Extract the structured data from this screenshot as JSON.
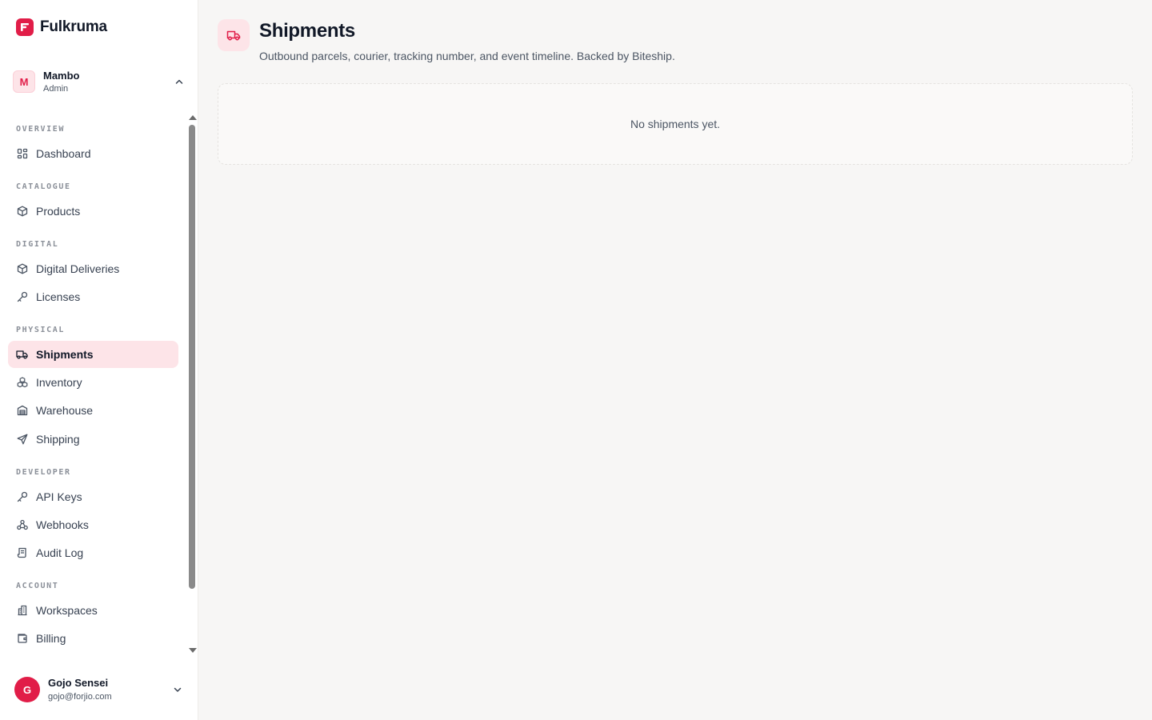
{
  "brand": {
    "name": "Fulkruma",
    "accent": "#e11d48"
  },
  "workspace": {
    "initial": "M",
    "name": "Mambo",
    "role": "Admin"
  },
  "nav": {
    "sections": [
      {
        "label": "OVERVIEW",
        "items": [
          {
            "label": "Dashboard",
            "icon": "dashboard-icon"
          }
        ]
      },
      {
        "label": "CATALOGUE",
        "items": [
          {
            "label": "Products",
            "icon": "box-icon"
          }
        ]
      },
      {
        "label": "DIGITAL",
        "items": [
          {
            "label": "Digital Deliveries",
            "icon": "box-icon"
          },
          {
            "label": "Licenses",
            "icon": "key-icon"
          }
        ]
      },
      {
        "label": "PHYSICAL",
        "items": [
          {
            "label": "Shipments",
            "icon": "truck-icon",
            "active": true
          },
          {
            "label": "Inventory",
            "icon": "boxes-icon"
          },
          {
            "label": "Warehouse",
            "icon": "warehouse-icon"
          },
          {
            "label": "Shipping",
            "icon": "send-icon"
          }
        ]
      },
      {
        "label": "DEVELOPER",
        "items": [
          {
            "label": "API Keys",
            "icon": "key-icon"
          },
          {
            "label": "Webhooks",
            "icon": "webhook-icon"
          },
          {
            "label": "Audit Log",
            "icon": "scroll-icon"
          }
        ]
      },
      {
        "label": "ACCOUNT",
        "items": [
          {
            "label": "Workspaces",
            "icon": "building-icon"
          },
          {
            "label": "Billing",
            "icon": "wallet-icon"
          }
        ]
      }
    ]
  },
  "user": {
    "initial": "G",
    "name": "Gojo Sensei",
    "email": "gojo@forjio.com"
  },
  "page": {
    "title": "Shipments",
    "subtitle": "Outbound parcels, courier, tracking number, and event timeline. Backed by Biteship.",
    "empty_message": "No shipments yet."
  }
}
